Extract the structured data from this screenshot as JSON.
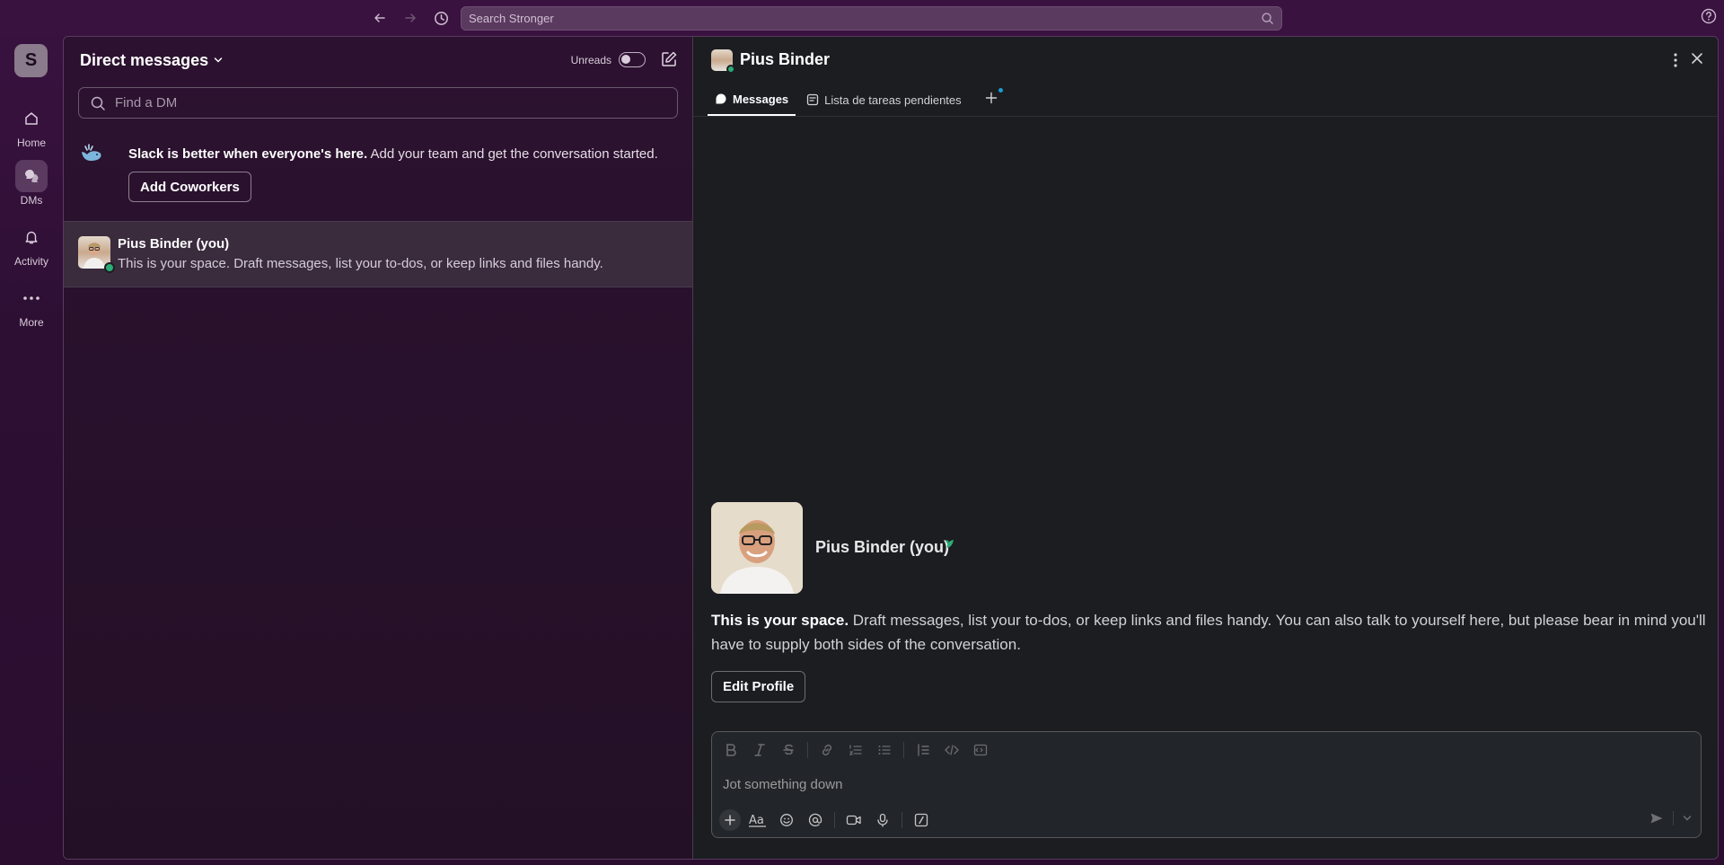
{
  "topbar": {
    "search_placeholder": "Search Stronger"
  },
  "rail": {
    "workspace_initial": "S",
    "items": [
      {
        "label": "Home"
      },
      {
        "label": "DMs"
      },
      {
        "label": "Activity"
      },
      {
        "label": "More"
      }
    ]
  },
  "dm_list": {
    "title": "Direct messages",
    "unreads_label": "Unreads",
    "find_placeholder": "Find a DM",
    "promo_bold": "Slack is better when everyone's here.",
    "promo_rest": " Add your team and get the conversation started.",
    "add_coworkers_label": "Add Coworkers",
    "rows": [
      {
        "name": "Pius Binder (you)",
        "preview": "This is your space. Draft messages, list your to-dos, or keep links and files handy."
      }
    ]
  },
  "conversation": {
    "title": "Pius Binder",
    "tabs": [
      {
        "label": "Messages"
      },
      {
        "label": "Lista de tareas pendientes"
      }
    ],
    "profile_name": "Pius Binder (you)",
    "intro_bold": "This is your space.",
    "intro_rest": " Draft messages, list your to-dos, or keep links and files handy. You can also talk to yourself here, but please bear in mind you'll have to supply both sides of the conversation.",
    "edit_profile_label": "Edit Profile",
    "composer_placeholder": "Jot something down"
  },
  "colors": {
    "status_green": "#2bac76",
    "accent_blue": "#1d9bd1"
  }
}
